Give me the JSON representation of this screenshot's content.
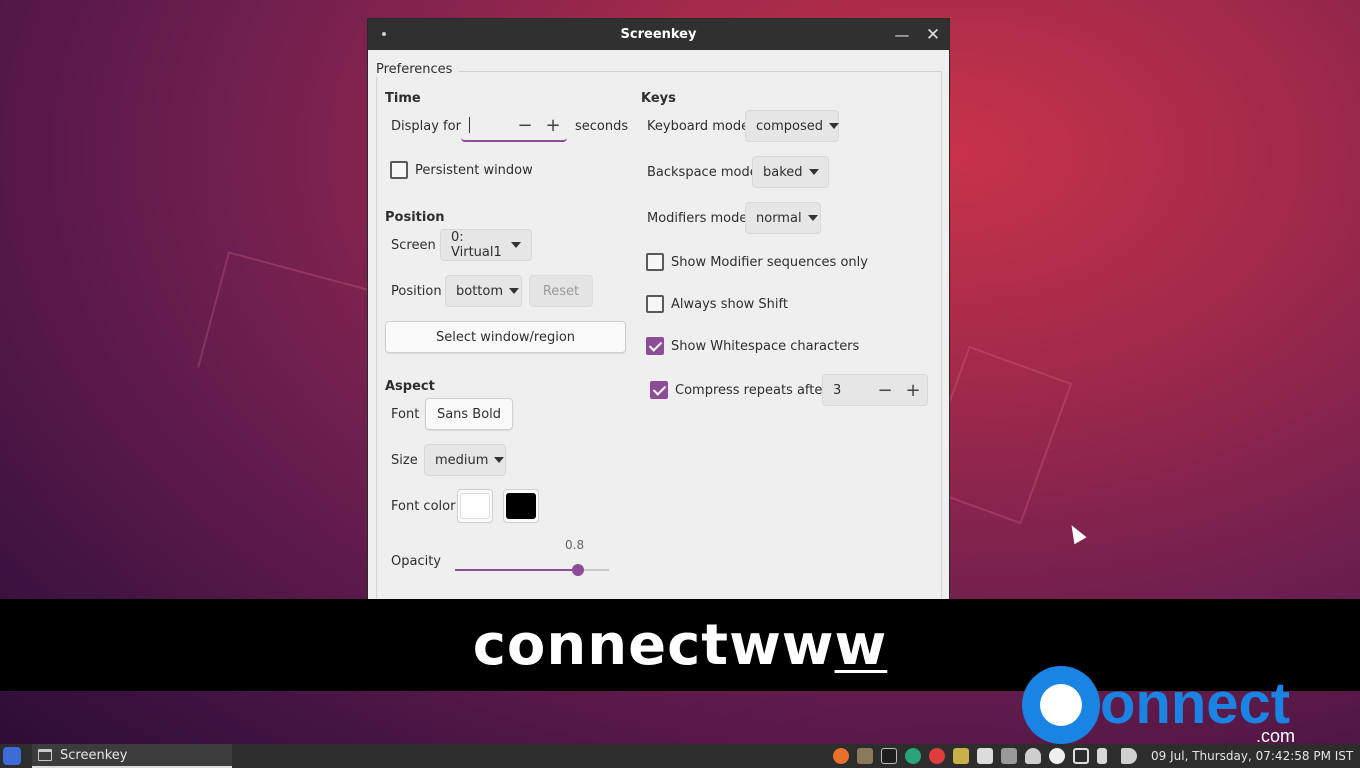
{
  "window": {
    "title": "Screenkey"
  },
  "preferences": {
    "frame_label": "Preferences",
    "time": {
      "heading": "Time",
      "display_for_label": "Display for",
      "display_for_value": "",
      "seconds_label": "seconds",
      "persistent_label": "Persistent window",
      "persistent_checked": false
    },
    "position": {
      "heading": "Position",
      "screen_label": "Screen",
      "screen_value": "0: Virtual1",
      "position_label": "Position",
      "position_value": "bottom",
      "reset_label": "Reset",
      "select_label": "Select window/region"
    },
    "aspect": {
      "heading": "Aspect",
      "font_label": "Font",
      "font_value": "Sans Bold",
      "size_label": "Size",
      "size_value": "medium",
      "font_color_label": "Font color",
      "font_color_fg": "#ffffff",
      "font_color_bg": "#000000",
      "opacity_label": "Opacity",
      "opacity_value": "0.8",
      "opacity": 0.8
    },
    "keys": {
      "heading": "Keys",
      "keyboard_mode_label": "Keyboard mode",
      "keyboard_mode_value": "composed",
      "backspace_mode_label": "Backspace mode",
      "backspace_mode_value": "baked",
      "modifiers_mode_label": "Modifiers mode",
      "modifiers_mode_value": "normal",
      "show_modifier_label": "Show Modifier sequences only",
      "show_modifier_checked": false,
      "always_shift_label": "Always show Shift",
      "always_shift_checked": false,
      "show_whitespace_label": "Show Whitespace characters",
      "show_whitespace_checked": true,
      "compress_label": "Compress repeats after",
      "compress_checked": true,
      "compress_value": "3"
    }
  },
  "overlay": {
    "text_main": "connectww",
    "text_underlined": "w"
  },
  "taskbar": {
    "task_label": "Screenkey",
    "clock": "09 Jul, Thursday, 07:42:58 PM IST",
    "tray_icons": [
      "firefox-icon",
      "gimp-icon",
      "terminal-icon",
      "shutter-icon",
      "pen-icon",
      "files-icon",
      "window-icon",
      "keyboard-icon",
      "bell-icon",
      "mega-icon",
      "display-icon",
      "battery-icon",
      "volume-icon"
    ]
  },
  "logo": {
    "word": "onnect",
    "suffix": ".com"
  },
  "colors": {
    "accent": "#8d4c96",
    "titlebar": "#303030"
  }
}
